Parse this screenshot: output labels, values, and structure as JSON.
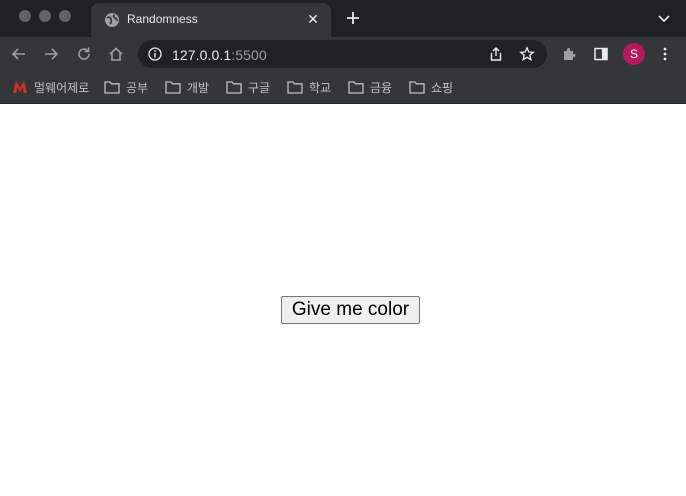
{
  "browser": {
    "tab": {
      "title": "Randomness"
    },
    "address": {
      "host": "127.0.0.1",
      "port": ":5500"
    },
    "profile_initial": "S",
    "bookmarks": [
      {
        "label": "멀웨어제로",
        "icon": "malwarezero-logo"
      },
      {
        "label": "공부",
        "icon": "folder-icon"
      },
      {
        "label": "개발",
        "icon": "folder-icon"
      },
      {
        "label": "구글",
        "icon": "folder-icon"
      },
      {
        "label": "학교",
        "icon": "folder-icon"
      },
      {
        "label": "금융",
        "icon": "folder-icon"
      },
      {
        "label": "쇼핑",
        "icon": "folder-icon"
      }
    ]
  },
  "page": {
    "button_label": "Give me color"
  },
  "colors": {
    "chrome_dark": "#202124",
    "chrome_toolbar": "#35363a",
    "avatar": "#b51a5f",
    "malwarezero_red": "#d93025"
  }
}
